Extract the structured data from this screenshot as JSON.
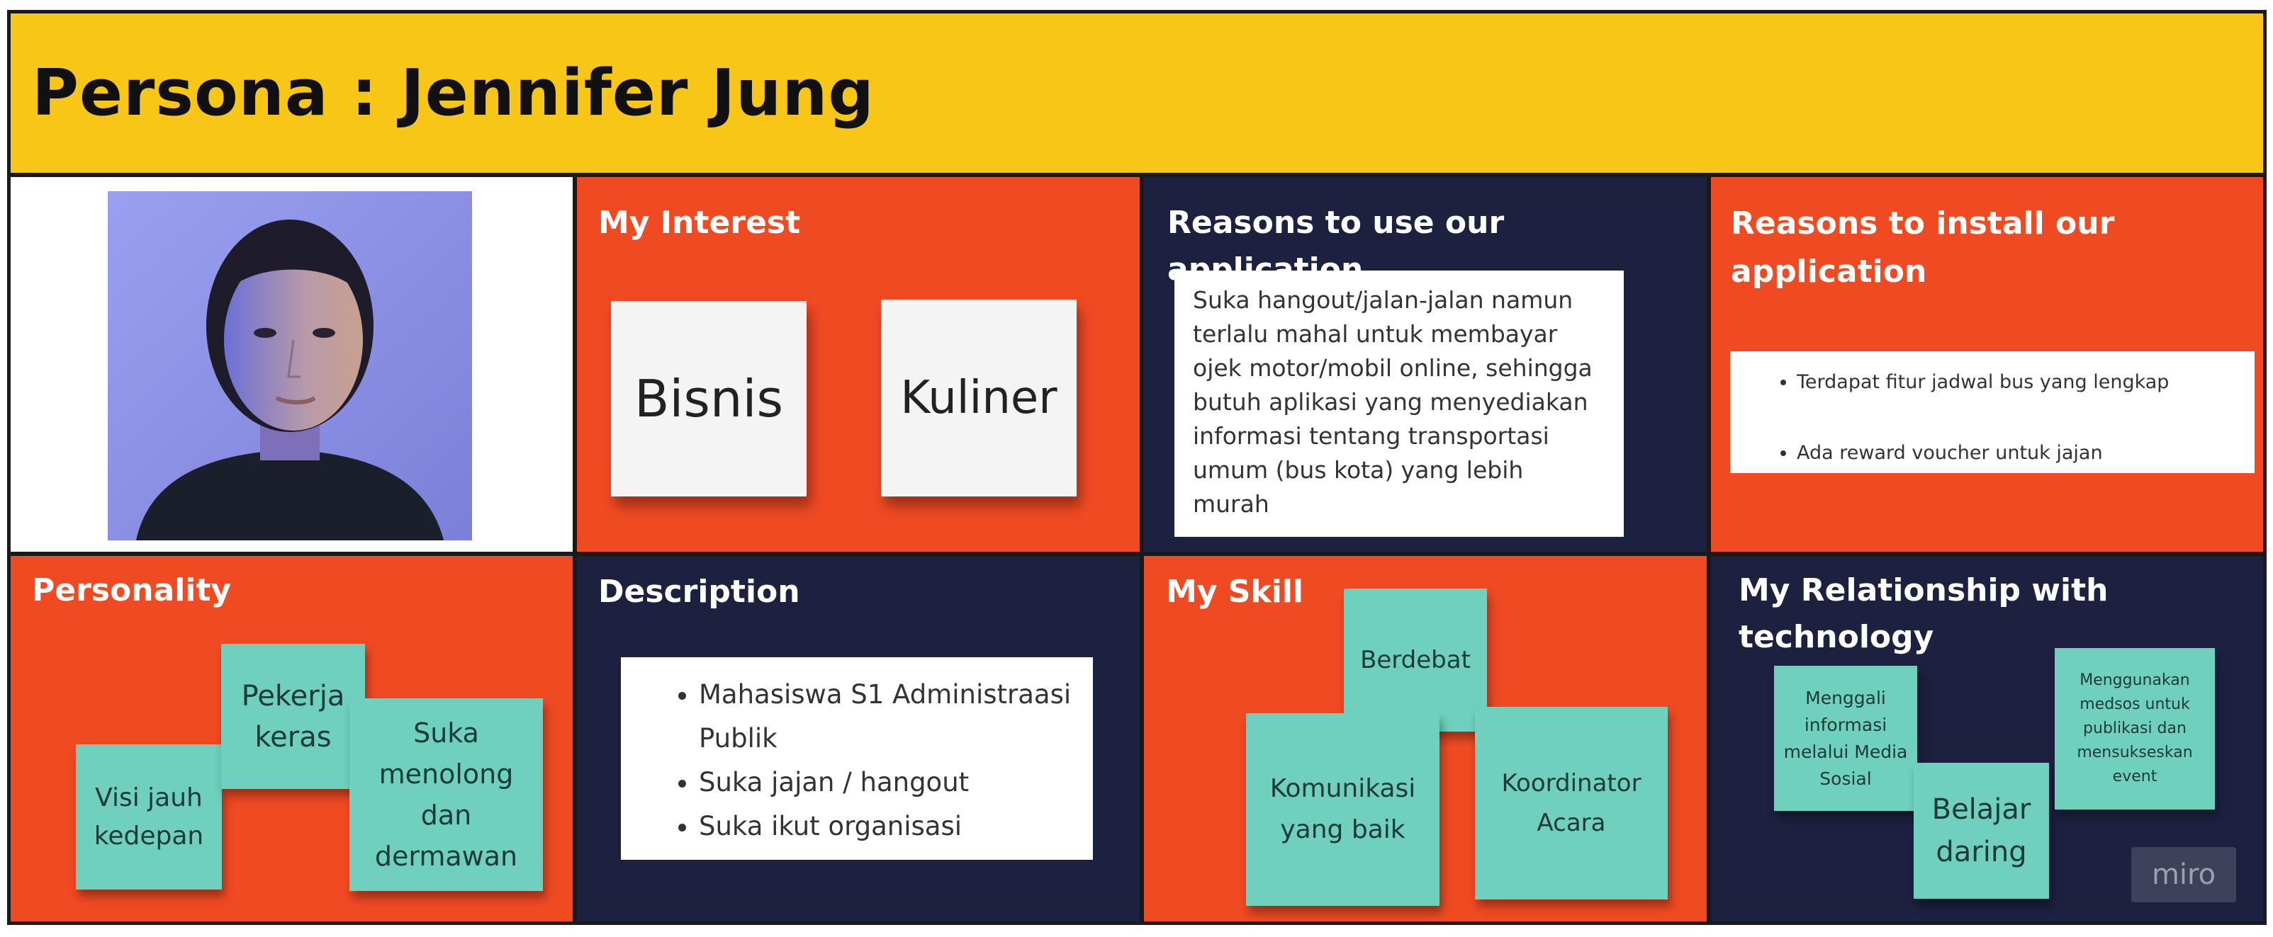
{
  "header": {
    "title": "Persona : Jennifer Jung"
  },
  "interest": {
    "title": "My Interest",
    "notes": [
      "Bisnis",
      "Kuliner"
    ]
  },
  "reasons_use": {
    "title": "Reasons to use our application",
    "text": "Suka hangout/jalan-jalan namun terlalu mahal untuk membayar ojek motor/mobil online, sehingga butuh aplikasi yang menyediakan informasi tentang transportasi umum (bus kota) yang lebih murah"
  },
  "reasons_install": {
    "title": "Reasons to install our application",
    "items": [
      "Terdapat fitur jadwal bus yang lengkap",
      "Ada reward voucher untuk jajan"
    ]
  },
  "personality": {
    "title": "Personality",
    "notes": [
      "Visi jauh kedepan",
      "Pekerja keras",
      "Suka menolong dan dermawan"
    ]
  },
  "description": {
    "title": "Description",
    "items": [
      "Mahasiswa S1 Administraasi Publik",
      "Suka jajan / hangout",
      "Suka ikut organisasi"
    ]
  },
  "skill": {
    "title": "My Skill",
    "notes": [
      "Berdebat",
      "Komunikasi yang baik",
      "Koordinator Acara"
    ]
  },
  "relationship": {
    "title": "My Relationship with technology",
    "notes": [
      "Menggali informasi melalui Media Sosial",
      "Belajar daring",
      "Menggunakan medsos untuk publikasi dan mensukseskan event"
    ]
  },
  "watermark": "miro",
  "colors": {
    "header": "#f7c617",
    "orange": "#f04a23",
    "navy": "#1c2140",
    "sticky": "#6fd0bd"
  },
  "icons": [
    "persona-photo",
    "miro-logo"
  ]
}
